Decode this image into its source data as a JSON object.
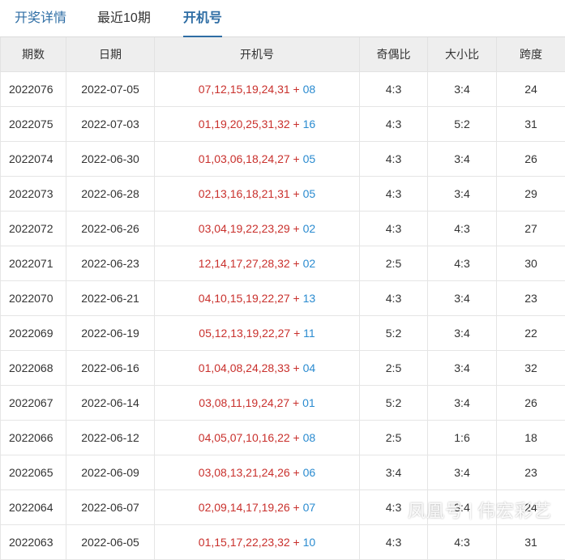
{
  "tabs": [
    {
      "label": "开奖详情"
    },
    {
      "label": "最近10期"
    },
    {
      "label": "开机号"
    }
  ],
  "table": {
    "headers": [
      "期数",
      "日期",
      "开机号",
      "奇偶比",
      "大小比",
      "跨度"
    ],
    "rows": [
      {
        "issue": "2022076",
        "date": "2022-07-05",
        "front": "07,12,15,19,24,31",
        "back": "08",
        "odd_even": "4:3",
        "big_small": "3:4",
        "span": "24"
      },
      {
        "issue": "2022075",
        "date": "2022-07-03",
        "front": "01,19,20,25,31,32",
        "back": "16",
        "odd_even": "4:3",
        "big_small": "5:2",
        "span": "31"
      },
      {
        "issue": "2022074",
        "date": "2022-06-30",
        "front": "01,03,06,18,24,27",
        "back": "05",
        "odd_even": "4:3",
        "big_small": "3:4",
        "span": "26"
      },
      {
        "issue": "2022073",
        "date": "2022-06-28",
        "front": "02,13,16,18,21,31",
        "back": "05",
        "odd_even": "4:3",
        "big_small": "3:4",
        "span": "29"
      },
      {
        "issue": "2022072",
        "date": "2022-06-26",
        "front": "03,04,19,22,23,29",
        "back": "02",
        "odd_even": "4:3",
        "big_small": "4:3",
        "span": "27"
      },
      {
        "issue": "2022071",
        "date": "2022-06-23",
        "front": "12,14,17,27,28,32",
        "back": "02",
        "odd_even": "2:5",
        "big_small": "4:3",
        "span": "30"
      },
      {
        "issue": "2022070",
        "date": "2022-06-21",
        "front": "04,10,15,19,22,27",
        "back": "13",
        "odd_even": "4:3",
        "big_small": "3:4",
        "span": "23"
      },
      {
        "issue": "2022069",
        "date": "2022-06-19",
        "front": "05,12,13,19,22,27",
        "back": "11",
        "odd_even": "5:2",
        "big_small": "3:4",
        "span": "22"
      },
      {
        "issue": "2022068",
        "date": "2022-06-16",
        "front": "01,04,08,24,28,33",
        "back": "04",
        "odd_even": "2:5",
        "big_small": "3:4",
        "span": "32"
      },
      {
        "issue": "2022067",
        "date": "2022-06-14",
        "front": "03,08,11,19,24,27",
        "back": "01",
        "odd_even": "5:2",
        "big_small": "3:4",
        "span": "26"
      },
      {
        "issue": "2022066",
        "date": "2022-06-12",
        "front": "04,05,07,10,16,22",
        "back": "08",
        "odd_even": "2:5",
        "big_small": "1:6",
        "span": "18"
      },
      {
        "issue": "2022065",
        "date": "2022-06-09",
        "front": "03,08,13,21,24,26",
        "back": "06",
        "odd_even": "3:4",
        "big_small": "3:4",
        "span": "23"
      },
      {
        "issue": "2022064",
        "date": "2022-06-07",
        "front": "02,09,14,17,19,26",
        "back": "07",
        "odd_even": "4:3",
        "big_small": "3:4",
        "span": "24"
      },
      {
        "issue": "2022063",
        "date": "2022-06-05",
        "front": "01,15,17,22,23,32",
        "back": "10",
        "odd_even": "4:3",
        "big_small": "4:3",
        "span": "31"
      }
    ]
  },
  "watermark": {
    "left": "凤凰号",
    "right": "伟宏彩艺"
  }
}
